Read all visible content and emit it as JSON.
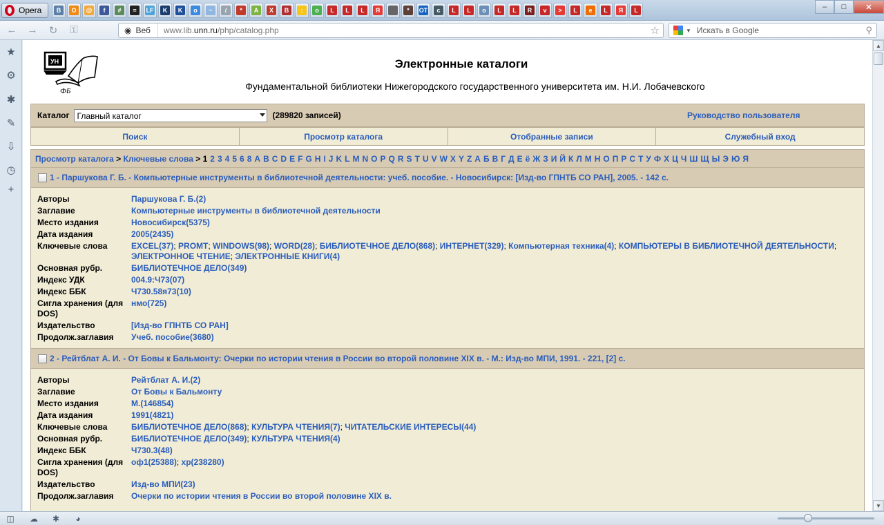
{
  "browser": {
    "menu_label": "Opera",
    "tabs": [
      {
        "icon": "vk-icon",
        "color": "#5b7fa6",
        "glyph": "B"
      },
      {
        "icon": "odnoklassniki-icon",
        "color": "#f08a12",
        "glyph": "O"
      },
      {
        "icon": "mail-icon",
        "color": "#f2a93b",
        "glyph": "@"
      },
      {
        "icon": "facebook-icon",
        "color": "#3b5998",
        "glyph": "f"
      },
      {
        "icon": "app-icon",
        "color": "#5a8a5a",
        "glyph": "#"
      },
      {
        "icon": "terminal-icon",
        "color": "#222222",
        "glyph": "="
      },
      {
        "icon": "lf-icon",
        "color": "#4ea3d8",
        "glyph": "LF"
      },
      {
        "icon": "k-icon",
        "color": "#1b3d6e",
        "glyph": "K"
      },
      {
        "icon": "kk-icon",
        "color": "#1e4f9c",
        "glyph": "K"
      },
      {
        "icon": "drop-icon",
        "color": "#3d8be0",
        "glyph": "o"
      },
      {
        "icon": "weather-icon",
        "color": "#8fb7e0",
        "glyph": "~"
      },
      {
        "icon": "paper-icon",
        "color": "#9aa4ae",
        "glyph": "/"
      },
      {
        "icon": "puzzle-icon",
        "color": "#c0392b",
        "glyph": "*"
      },
      {
        "icon": "android-icon",
        "color": "#7cb342",
        "glyph": "A"
      },
      {
        "icon": "joomla-icon",
        "color": "#c0392b",
        "glyph": "X"
      },
      {
        "icon": "book-icon",
        "color": "#b03030",
        "glyph": "B"
      },
      {
        "icon": "smiley-icon",
        "color": "#f5c518",
        "glyph": ":"
      },
      {
        "icon": "chrome-icon",
        "color": "#4caf50",
        "glyph": "o"
      },
      {
        "icon": "lib-icon",
        "color": "#c62828",
        "glyph": "L"
      },
      {
        "icon": "lib-icon",
        "color": "#c62828",
        "glyph": "L"
      },
      {
        "icon": "lib-icon",
        "color": "#c62828",
        "glyph": "L"
      },
      {
        "icon": "yandex-icon",
        "color": "#e53935",
        "glyph": "Я"
      },
      {
        "icon": "gray-icon",
        "color": "#666666",
        "glyph": ""
      },
      {
        "icon": "photo-icon",
        "color": "#5d4037",
        "glyph": "*"
      },
      {
        "icon": "ot-icon",
        "color": "#1565c0",
        "glyph": "OT"
      },
      {
        "icon": "car-icon",
        "color": "#455a64",
        "glyph": "c"
      },
      {
        "icon": "lib-icon",
        "color": "#c62828",
        "glyph": "L"
      },
      {
        "icon": "lib-icon",
        "color": "#c62828",
        "glyph": "L"
      },
      {
        "icon": "globe-icon",
        "color": "#6d8fb5",
        "glyph": "o"
      },
      {
        "icon": "lib-icon",
        "color": "#c62828",
        "glyph": "L"
      },
      {
        "icon": "lib-icon",
        "color": "#c62828",
        "glyph": "L"
      },
      {
        "icon": "r-icon",
        "color": "#7a1f1f",
        "glyph": "R"
      },
      {
        "icon": "shield-icon",
        "color": "#c62828",
        "glyph": "v"
      },
      {
        "icon": "youtube-icon",
        "color": "#e53935",
        "glyph": ">"
      },
      {
        "icon": "lib-icon",
        "color": "#c62828",
        "glyph": "L"
      },
      {
        "icon": "note-icon",
        "color": "#ef6c00",
        "glyph": "e"
      },
      {
        "icon": "lib-icon",
        "color": "#c62828",
        "glyph": "L"
      },
      {
        "icon": "yandex-icon",
        "color": "#e53935",
        "glyph": "Я"
      },
      {
        "icon": "lib-icon",
        "color": "#c62828",
        "glyph": "L"
      }
    ],
    "address": {
      "label": "Веб",
      "url_prefix": "www.lib.",
      "url_domain": "unn.ru",
      "url_path": "/php/catalog.php"
    },
    "search_placeholder": "Искать в Google",
    "zoom_level": 0.3
  },
  "page": {
    "title": "Электронные каталоги",
    "subtitle": "Фундаментальной библиотеки Нижегородского государственного университета им. Н.И. Лобачевского",
    "catalog_label": "Каталог",
    "catalog_selected": "Главный каталог",
    "record_count": "(289820 записей)",
    "guide_link": "Руководство пользователя",
    "menu": [
      "Поиск",
      "Просмотр каталога",
      "Отобранные записи",
      "Служебный вход"
    ],
    "breadcrumb": {
      "root": "Просмотр каталога",
      "sep1": ">",
      "current": "Ключевые слова",
      "sep2": ">"
    },
    "alphabet": [
      "1",
      "2",
      "3",
      "4",
      "5",
      "6",
      "8",
      "A",
      "B",
      "C",
      "D",
      "E",
      "F",
      "G",
      "H",
      "I",
      "J",
      "K",
      "L",
      "M",
      "N",
      "O",
      "P",
      "Q",
      "R",
      "S",
      "T",
      "U",
      "V",
      "W",
      "X",
      "Y",
      "Z",
      "А",
      "Б",
      "В",
      "Г",
      "Д",
      "Е",
      "ё",
      "Ж",
      "З",
      "И",
      "Й",
      "К",
      "Л",
      "М",
      "Н",
      "О",
      "П",
      "Р",
      "С",
      "Т",
      "У",
      "Ф",
      "Х",
      "Ц",
      "Ч",
      "Ш",
      "Щ",
      "Ы",
      "Э",
      "Ю",
      "Я"
    ],
    "records": [
      {
        "title": "1 - Паршукова Г. Б. - Компьютерные инструменты в библиотечной деятельности: учеб. пособие. - Новосибирск: [Изд-во ГПНТБ СО РАН], 2005. - 142 с.",
        "fields": [
          {
            "name": "Авторы",
            "values": [
              "Паршукова Г. Б.(2)"
            ]
          },
          {
            "name": "Заглавие",
            "values": [
              "Компьютерные инструменты в библиотечной деятельности"
            ]
          },
          {
            "name": "Место издания",
            "values": [
              "Новосибирск(5375)"
            ]
          },
          {
            "name": "Дата издания",
            "values": [
              "2005(2435)"
            ]
          },
          {
            "name": "Ключевые слова",
            "values": [
              "EXCEL(37)",
              "PROMT",
              "WINDOWS(98)",
              "WORD(28)",
              "БИБЛИОТЕЧНОЕ ДЕЛО(868)",
              "ИНТЕРНЕТ(329)",
              "Компьютерная техника(4)",
              "КОМПЬЮТЕРЫ В БИБЛИОТЕЧНОЙ ДЕЯТЕЛЬНОСТИ",
              "ЭЛЕКТРОННОЕ ЧТЕНИЕ",
              "ЭЛЕКТРОННЫЕ КНИГИ(4)"
            ]
          },
          {
            "name": "Основная рубр.",
            "values": [
              "БИБЛИОТЕЧНОЕ ДЕЛО(349)"
            ]
          },
          {
            "name": "Индекс УДК",
            "values": [
              "004.9:Ч73(07)"
            ]
          },
          {
            "name": "Индекс ББК",
            "values": [
              "Ч730.58я73(10)"
            ]
          },
          {
            "name": "Сигла хранения (для DOS)",
            "values": [
              "нмо(725)"
            ]
          },
          {
            "name": "Издательство",
            "values": [
              "[Изд-во ГПНТБ СО РАН]"
            ]
          },
          {
            "name": "Продолж.заглавия",
            "values": [
              "Учеб. пособие(3680)"
            ]
          }
        ]
      },
      {
        "title": "2 - Рейтблат А. И. - От Бовы к Бальмонту: Очерки по истории чтения в России во второй половине XIX в. - М.: Изд-во МПИ, 1991. - 221, [2] с.",
        "fields": [
          {
            "name": "Авторы",
            "values": [
              "Рейтблат А. И.(2)"
            ]
          },
          {
            "name": "Заглавие",
            "values": [
              "От Бовы к Бальмонту"
            ]
          },
          {
            "name": "Место издания",
            "values": [
              "М.(146854)"
            ]
          },
          {
            "name": "Дата издания",
            "values": [
              "1991(4821)"
            ]
          },
          {
            "name": "Ключевые слова",
            "values": [
              "БИБЛИОТЕЧНОЕ ДЕЛО(868)",
              "КУЛЬТУРА ЧТЕНИЯ(7)",
              "ЧИТАТЕЛЬСКИЕ ИНТЕРЕСЫ(44)"
            ]
          },
          {
            "name": "Основная рубр.",
            "values": [
              "БИБЛИОТЕЧНОЕ ДЕЛО(349)",
              "КУЛЬТУРА ЧТЕНИЯ(4)"
            ]
          },
          {
            "name": "Индекс ББК",
            "values": [
              "Ч730.3(48)"
            ]
          },
          {
            "name": "Сигла хранения (для DOS)",
            "values": [
              "оф1(25388)",
              "хр(238280)"
            ]
          },
          {
            "name": "Издательство",
            "values": [
              "Изд-во МПИ(23)"
            ]
          },
          {
            "name": "Продолж.заглавия",
            "values": [
              "Очерки по истории чтения в России во второй половине XIX в."
            ]
          }
        ]
      }
    ]
  }
}
